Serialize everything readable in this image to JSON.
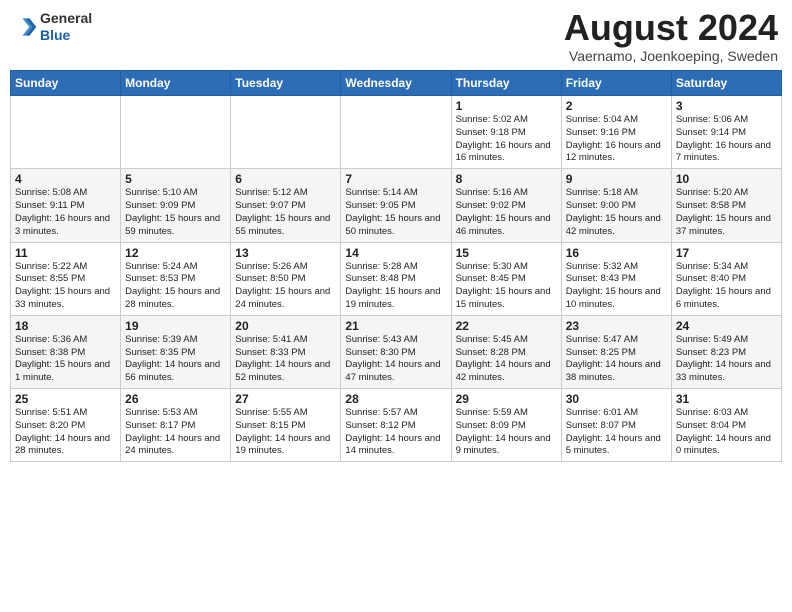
{
  "header": {
    "logo_general": "General",
    "logo_blue": "Blue",
    "month_year": "August 2024",
    "location": "Vaernamo, Joenkoeping, Sweden"
  },
  "days_of_week": [
    "Sunday",
    "Monday",
    "Tuesday",
    "Wednesday",
    "Thursday",
    "Friday",
    "Saturday"
  ],
  "weeks": [
    [
      {
        "day": "",
        "info": ""
      },
      {
        "day": "",
        "info": ""
      },
      {
        "day": "",
        "info": ""
      },
      {
        "day": "",
        "info": ""
      },
      {
        "day": "1",
        "info": "Sunrise: 5:02 AM\nSunset: 9:18 PM\nDaylight: 16 hours\nand 16 minutes."
      },
      {
        "day": "2",
        "info": "Sunrise: 5:04 AM\nSunset: 9:16 PM\nDaylight: 16 hours\nand 12 minutes."
      },
      {
        "day": "3",
        "info": "Sunrise: 5:06 AM\nSunset: 9:14 PM\nDaylight: 16 hours\nand 7 minutes."
      }
    ],
    [
      {
        "day": "4",
        "info": "Sunrise: 5:08 AM\nSunset: 9:11 PM\nDaylight: 16 hours\nand 3 minutes."
      },
      {
        "day": "5",
        "info": "Sunrise: 5:10 AM\nSunset: 9:09 PM\nDaylight: 15 hours\nand 59 minutes."
      },
      {
        "day": "6",
        "info": "Sunrise: 5:12 AM\nSunset: 9:07 PM\nDaylight: 15 hours\nand 55 minutes."
      },
      {
        "day": "7",
        "info": "Sunrise: 5:14 AM\nSunset: 9:05 PM\nDaylight: 15 hours\nand 50 minutes."
      },
      {
        "day": "8",
        "info": "Sunrise: 5:16 AM\nSunset: 9:02 PM\nDaylight: 15 hours\nand 46 minutes."
      },
      {
        "day": "9",
        "info": "Sunrise: 5:18 AM\nSunset: 9:00 PM\nDaylight: 15 hours\nand 42 minutes."
      },
      {
        "day": "10",
        "info": "Sunrise: 5:20 AM\nSunset: 8:58 PM\nDaylight: 15 hours\nand 37 minutes."
      }
    ],
    [
      {
        "day": "11",
        "info": "Sunrise: 5:22 AM\nSunset: 8:55 PM\nDaylight: 15 hours\nand 33 minutes."
      },
      {
        "day": "12",
        "info": "Sunrise: 5:24 AM\nSunset: 8:53 PM\nDaylight: 15 hours\nand 28 minutes."
      },
      {
        "day": "13",
        "info": "Sunrise: 5:26 AM\nSunset: 8:50 PM\nDaylight: 15 hours\nand 24 minutes."
      },
      {
        "day": "14",
        "info": "Sunrise: 5:28 AM\nSunset: 8:48 PM\nDaylight: 15 hours\nand 19 minutes."
      },
      {
        "day": "15",
        "info": "Sunrise: 5:30 AM\nSunset: 8:45 PM\nDaylight: 15 hours\nand 15 minutes."
      },
      {
        "day": "16",
        "info": "Sunrise: 5:32 AM\nSunset: 8:43 PM\nDaylight: 15 hours\nand 10 minutes."
      },
      {
        "day": "17",
        "info": "Sunrise: 5:34 AM\nSunset: 8:40 PM\nDaylight: 15 hours\nand 6 minutes."
      }
    ],
    [
      {
        "day": "18",
        "info": "Sunrise: 5:36 AM\nSunset: 8:38 PM\nDaylight: 15 hours\nand 1 minute."
      },
      {
        "day": "19",
        "info": "Sunrise: 5:39 AM\nSunset: 8:35 PM\nDaylight: 14 hours\nand 56 minutes."
      },
      {
        "day": "20",
        "info": "Sunrise: 5:41 AM\nSunset: 8:33 PM\nDaylight: 14 hours\nand 52 minutes."
      },
      {
        "day": "21",
        "info": "Sunrise: 5:43 AM\nSunset: 8:30 PM\nDaylight: 14 hours\nand 47 minutes."
      },
      {
        "day": "22",
        "info": "Sunrise: 5:45 AM\nSunset: 8:28 PM\nDaylight: 14 hours\nand 42 minutes."
      },
      {
        "day": "23",
        "info": "Sunrise: 5:47 AM\nSunset: 8:25 PM\nDaylight: 14 hours\nand 38 minutes."
      },
      {
        "day": "24",
        "info": "Sunrise: 5:49 AM\nSunset: 8:23 PM\nDaylight: 14 hours\nand 33 minutes."
      }
    ],
    [
      {
        "day": "25",
        "info": "Sunrise: 5:51 AM\nSunset: 8:20 PM\nDaylight: 14 hours\nand 28 minutes."
      },
      {
        "day": "26",
        "info": "Sunrise: 5:53 AM\nSunset: 8:17 PM\nDaylight: 14 hours\nand 24 minutes."
      },
      {
        "day": "27",
        "info": "Sunrise: 5:55 AM\nSunset: 8:15 PM\nDaylight: 14 hours\nand 19 minutes."
      },
      {
        "day": "28",
        "info": "Sunrise: 5:57 AM\nSunset: 8:12 PM\nDaylight: 14 hours\nand 14 minutes."
      },
      {
        "day": "29",
        "info": "Sunrise: 5:59 AM\nSunset: 8:09 PM\nDaylight: 14 hours\nand 9 minutes."
      },
      {
        "day": "30",
        "info": "Sunrise: 6:01 AM\nSunset: 8:07 PM\nDaylight: 14 hours\nand 5 minutes."
      },
      {
        "day": "31",
        "info": "Sunrise: 6:03 AM\nSunset: 8:04 PM\nDaylight: 14 hours\nand 0 minutes."
      }
    ]
  ]
}
